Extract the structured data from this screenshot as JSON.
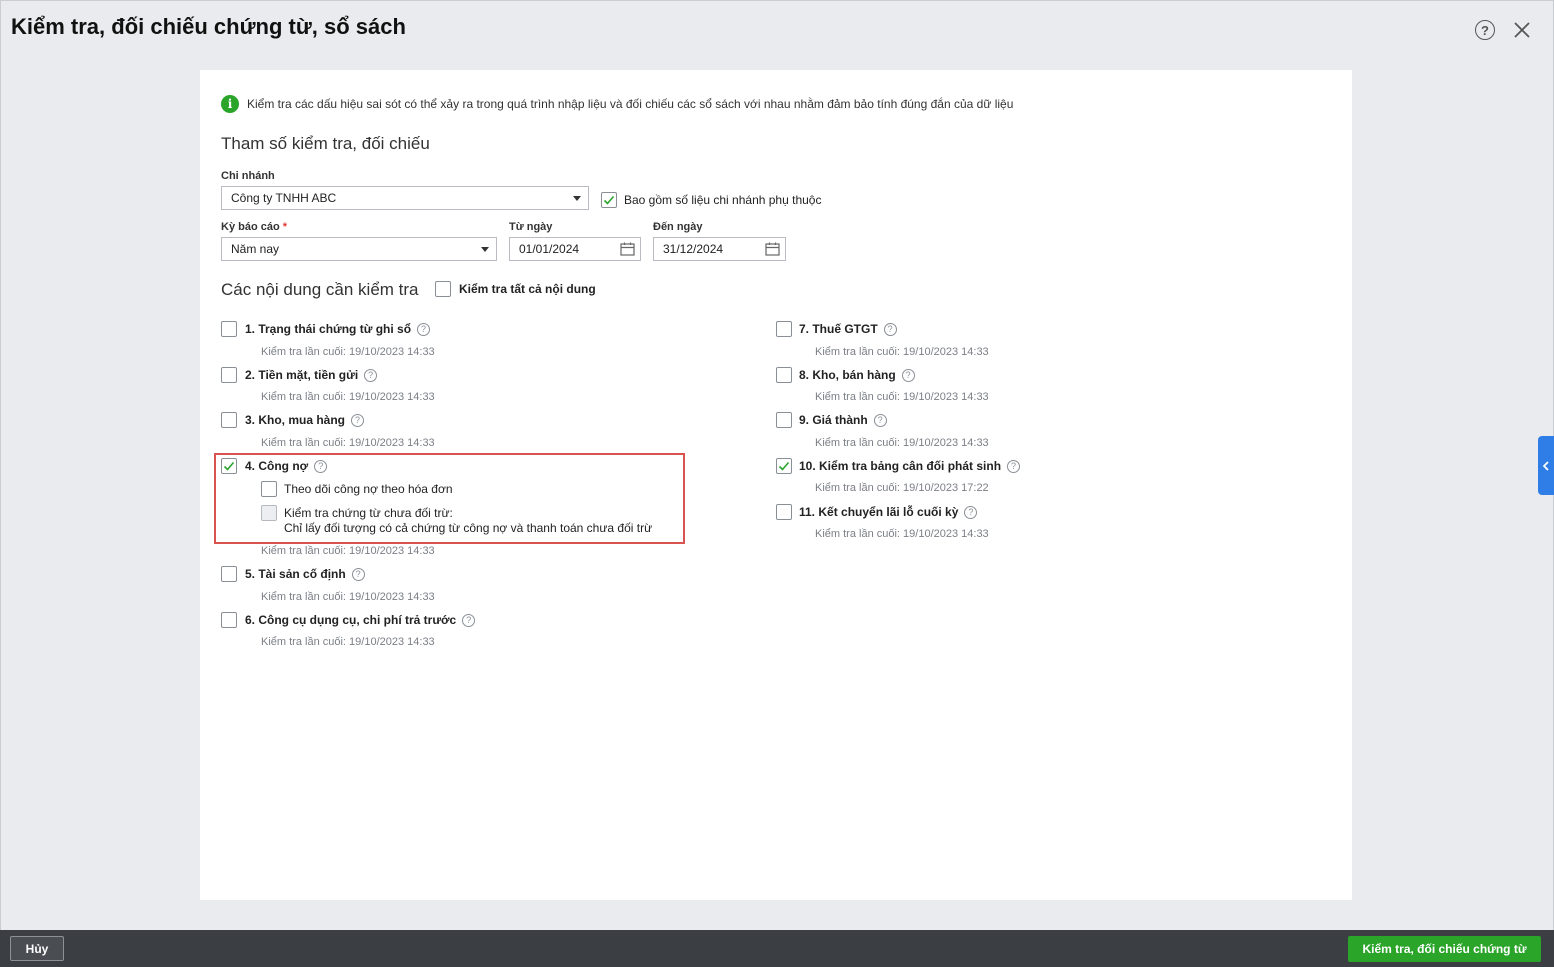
{
  "dialog": {
    "title": "Kiểm tra, đối chiếu chứng từ, sổ sách",
    "help_icon": "question-circle-icon",
    "close_icon": "close-icon"
  },
  "info": {
    "text": "Kiểm tra các dấu hiệu sai sót có thể xảy ra trong quá trình nhập liệu và đối chiếu các sổ sách với nhau nhằm đảm bảo tính đúng đắn của dữ liệu",
    "icon": "info-icon"
  },
  "params": {
    "section_title": "Tham số kiểm tra, đối chiếu",
    "branch_label": "Chi nhánh",
    "branch_value": "Công ty TNHH ABC",
    "include_branches_label": "Bao gồm số liệu chi nhánh phụ thuộc",
    "include_branches_checked": true,
    "period_label": "Kỳ báo cáo",
    "period_required": "*",
    "period_value": "Năm nay",
    "from_label": "Từ ngày",
    "from_value": "01/01/2024",
    "to_label": "Đến ngày",
    "to_value": "31/12/2024"
  },
  "contents": {
    "section_title": "Các nội dung cần kiểm tra",
    "check_all_label": "Kiểm tra tất cả nội dung",
    "check_all_checked": false,
    "items": [
      {
        "label": "1. Trạng thái chứng từ ghi sổ",
        "last": "Kiểm tra lần cuối: 19/10/2023 14:33",
        "checked": false
      },
      {
        "label": "2. Tiền mặt, tiền gửi",
        "last": "Kiểm tra lần cuối: 19/10/2023 14:33",
        "checked": false
      },
      {
        "label": "3. Kho, mua hàng",
        "last": "Kiểm tra lần cuối: 19/10/2023 14:33",
        "checked": false
      },
      {
        "label": "4. Công nợ",
        "last": "Kiểm tra lần cuối: 19/10/2023 14:33",
        "checked": true
      },
      {
        "label": "5. Tài sản cố định",
        "last": "Kiểm tra lần cuối: 19/10/2023 14:33",
        "checked": false
      },
      {
        "label": "6. Công cụ dụng cụ, chi phí trả trước",
        "last": "Kiểm tra lần cuối: 19/10/2023 14:33",
        "checked": false
      },
      {
        "label": "7. Thuế GTGT",
        "last": "Kiểm tra lần cuối: 19/10/2023 14:33",
        "checked": false
      },
      {
        "label": "8. Kho, bán hàng",
        "last": "Kiểm tra lần cuối: 19/10/2023 14:33",
        "checked": false
      },
      {
        "label": "9. Giá thành",
        "last": "Kiểm tra lần cuối: 19/10/2023 14:33",
        "checked": false
      },
      {
        "label": "10. Kiểm tra bảng cân đối phát sinh",
        "last": "Kiểm tra lần cuối: 19/10/2023 17:22",
        "checked": true
      },
      {
        "label": "11. Kết chuyển lãi lỗ cuối kỳ",
        "last": "Kiểm tra lần cuối: 19/10/2023 14:33",
        "checked": false
      }
    ],
    "debt_options": {
      "track_by_invoice": "Theo dõi công nợ theo hóa đơn",
      "unoffset_line1": "Kiểm tra chứng từ chưa đối trừ:",
      "unoffset_line2": "Chỉ lấy đối tượng có cả chứng từ công nợ và thanh toán chưa đối trừ"
    }
  },
  "footer": {
    "cancel_label": "Hủy",
    "submit_label": "Kiểm tra, đối chiếu chứng từ"
  },
  "colors": {
    "accent_green": "#2aa52a",
    "highlight_red": "#d9534f",
    "side_tab_blue": "#2f7ee8",
    "footer_dark": "#3b3e42"
  }
}
